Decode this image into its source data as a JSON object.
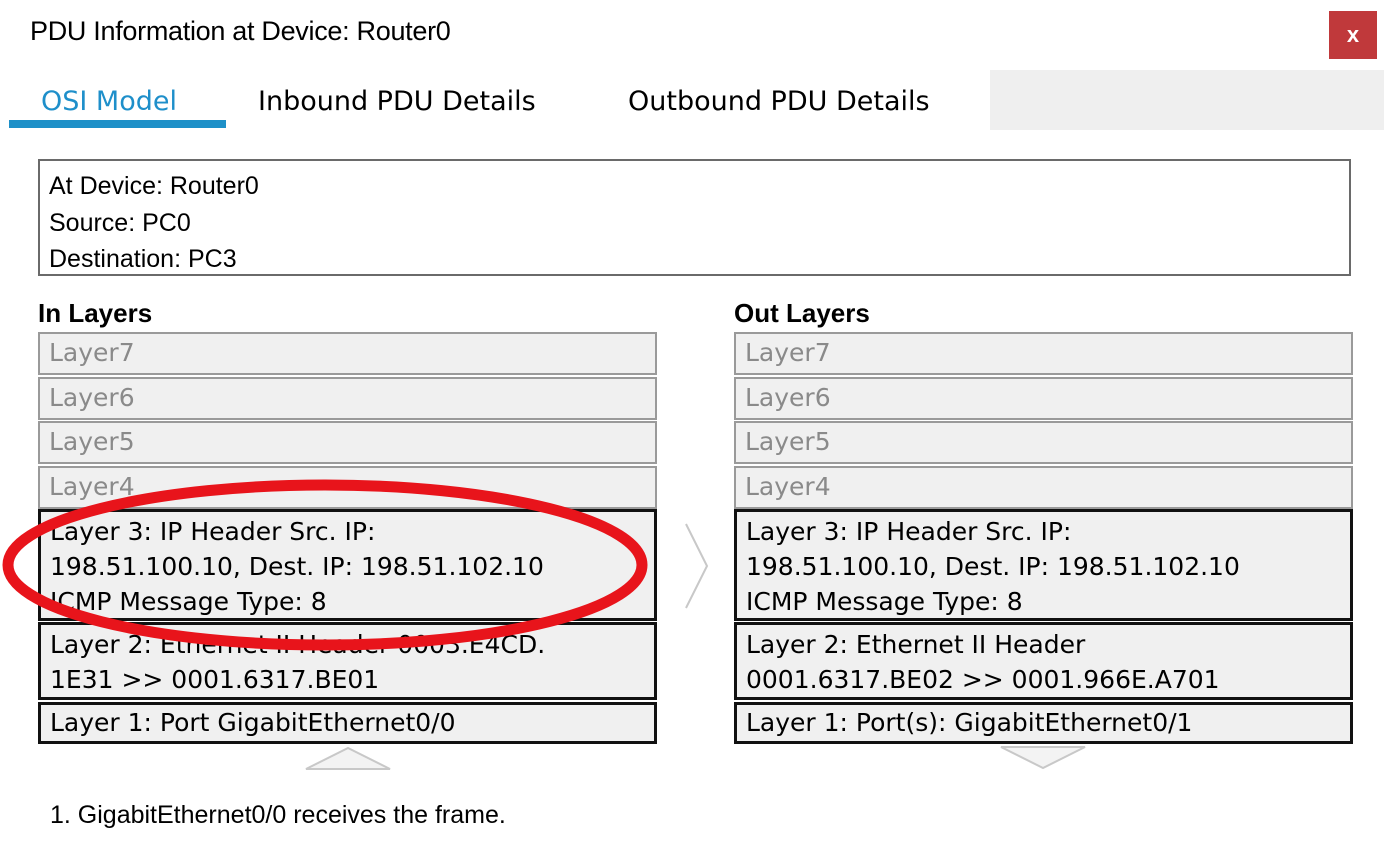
{
  "window": {
    "title": "PDU Information at Device: Router0",
    "close_label": "x"
  },
  "tabs": [
    {
      "label": "OSI Model",
      "active": true
    },
    {
      "label": "Inbound PDU Details",
      "active": false
    },
    {
      "label": "Outbound PDU Details",
      "active": false
    }
  ],
  "info": {
    "device": "At Device: Router0",
    "source": "Source: PC0",
    "destination": "Destination: PC3"
  },
  "in_layers": {
    "label": "In Layers",
    "layer7": "Layer7",
    "layer6": "Layer6",
    "layer5": "Layer5",
    "layer4": "Layer4",
    "layer3": [
      "Layer 3: IP Header Src. IP:",
      "198.51.100.10, Dest. IP: 198.51.102.10",
      "ICMP Message Type: 8"
    ],
    "layer2": [
      "Layer 2: Ethernet II Header 0003.E4CD.",
      "1E31 >> 0001.6317.BE01"
    ],
    "layer1": "Layer 1: Port GigabitEthernet0/0"
  },
  "out_layers": {
    "label": "Out Layers",
    "layer7": "Layer7",
    "layer6": "Layer6",
    "layer5": "Layer5",
    "layer4": "Layer4",
    "layer3": [
      "Layer 3: IP Header Src. IP:",
      "198.51.100.10, Dest. IP: 198.51.102.10",
      "ICMP Message Type: 8"
    ],
    "layer2": [
      "Layer 2: Ethernet II Header",
      "0001.6317.BE02 >> 0001.966E.A701"
    ],
    "layer1": "Layer 1: Port(s): GigabitEthernet0/1"
  },
  "status_text": "1. GigabitEthernet0/0 receives the frame.",
  "colors": {
    "accent": "#1e90c8",
    "close": "#c0393b",
    "highlight": "#e8141b"
  },
  "icons": {
    "close": "close-icon",
    "forward": "chevron-right-icon",
    "up": "chevron-up-icon",
    "down": "chevron-down-icon"
  }
}
